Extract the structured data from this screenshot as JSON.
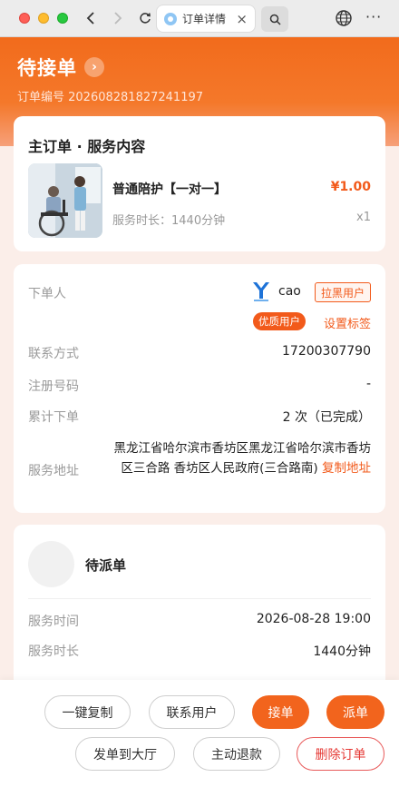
{
  "browser": {
    "tab_title": "订单详情",
    "tab_close": "×",
    "back_icon": "‹",
    "forward_icon": "›",
    "more_icon": "···"
  },
  "header": {
    "status": "待接单",
    "arrow": "›",
    "order_number": "订单编号 202608281827241197"
  },
  "service": {
    "title": "主订单 · 服务内容",
    "product_name": "普通陪护【一对一】",
    "price": "¥1.00",
    "duration": "服务时长：1440分钟",
    "quantity": "x1"
  },
  "customer": {
    "orderer_label": "下单人",
    "user_name": "cao",
    "blacklist_label": "拉黑用户",
    "vip_tag": "优质用户",
    "set_tag_label": "设置标签",
    "contact_label": "联系方式",
    "contact_value": "17200307790",
    "reg_label": "注册号码",
    "reg_value": "-",
    "count_label": "累计下单",
    "count_value": "2 次（已完成）",
    "address_label": "服务地址",
    "address_value": "黑龙江省哈尔滨市香坊区黑龙江省哈尔滨市香坊区三合路 香坊区人民政府(三合路南) ",
    "copy_address_label": "复制地址"
  },
  "dispatch": {
    "status": "待派单",
    "time_label": "服务时间",
    "time_value": "2026-08-28 19:00",
    "duration_label": "服务时长",
    "duration_value": "1440分钟"
  },
  "actions": {
    "copy": "一键复制",
    "contact": "联系用户",
    "accept": "接单",
    "dispatch": "派单",
    "hall": "发单到大厅",
    "refund": "主动退款",
    "delete": "删除订单"
  },
  "colors": {
    "brand": "#f2641d",
    "danger": "#e53935"
  }
}
